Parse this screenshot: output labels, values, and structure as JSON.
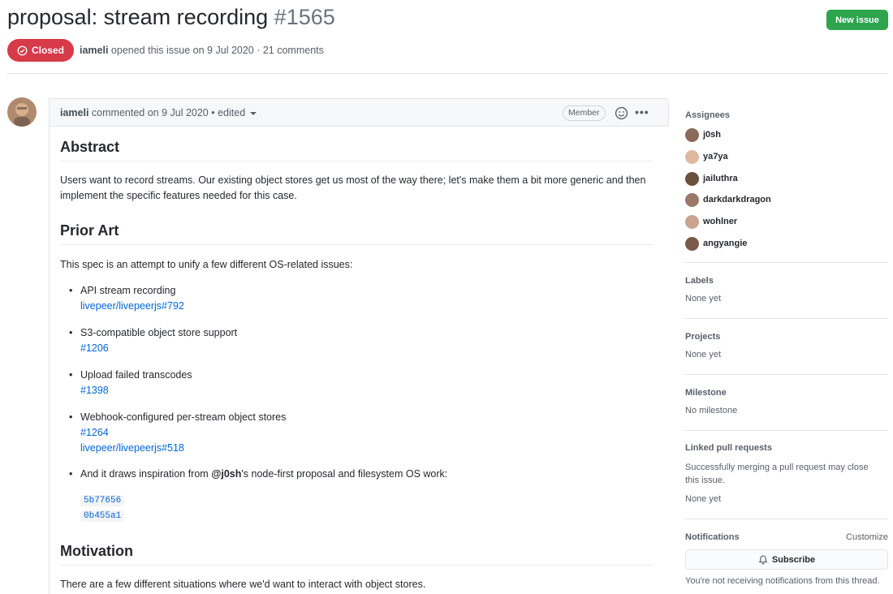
{
  "issue": {
    "title": "proposal: stream recording",
    "number": "#1565",
    "state": "Closed",
    "author": "iameli",
    "opened_text": "opened this issue on 9 Jul 2020 · 21 comments",
    "new_issue_label": "New issue"
  },
  "comment": {
    "author": "iameli",
    "meta": "commented on 9 Jul 2020 • edited",
    "role_badge": "Member",
    "sections": {
      "abstract_heading": "Abstract",
      "abstract_text": "Users want to record streams. Our existing object stores get us most of the way there; let's make them a bit more generic and then implement the specific features needed for this case.",
      "prior_art_heading": "Prior Art",
      "prior_art_intro": "This spec is an attempt to unify a few different OS-related issues:",
      "items": [
        {
          "text": "API stream recording",
          "links": [
            "livepeer/livepeerjs#792"
          ]
        },
        {
          "text": "S3-compatible object store support",
          "links": [
            "#1206"
          ]
        },
        {
          "text": "Upload failed transcodes",
          "links": [
            "#1398"
          ]
        },
        {
          "text": "Webhook-configured per-stream object stores",
          "links": [
            "#1264",
            "livepeer/livepeerjs#518"
          ]
        }
      ],
      "inspiration_pre": "And it draws inspiration from ",
      "inspiration_mention": "@j0sh",
      "inspiration_post": "'s node-first proposal and filesystem OS work:",
      "commits": [
        "5b77656",
        "0b455a1"
      ],
      "motivation_heading": "Motivation",
      "motivation_text": "There are a few different situations where we'd want to interact with object stores."
    }
  },
  "sidebar": {
    "assignees_title": "Assignees",
    "assignees": [
      {
        "name": "j0sh",
        "color": "#8a6a5a"
      },
      {
        "name": "ya7ya",
        "color": "#e0b8a0"
      },
      {
        "name": "jailuthra",
        "color": "#6b5040"
      },
      {
        "name": "darkdarkdragon",
        "color": "#9a7868"
      },
      {
        "name": "wohlner",
        "color": "#c9a58f"
      },
      {
        "name": "angyangie",
        "color": "#7a5a4a"
      }
    ],
    "labels_title": "Labels",
    "labels_value": "None yet",
    "projects_title": "Projects",
    "projects_value": "None yet",
    "milestone_title": "Milestone",
    "milestone_value": "No milestone",
    "linked_pr_title": "Linked pull requests",
    "linked_pr_desc": "Successfully merging a pull request may close this issue.",
    "linked_pr_value": "None yet",
    "notifications_title": "Notifications",
    "customize_label": "Customize",
    "subscribe_label": "Subscribe",
    "notifications_note": "You're not receiving notifications from this thread."
  },
  "colors": {
    "closed": "#d73a49",
    "new_issue": "#2ea44f",
    "link": "#0366d6"
  }
}
